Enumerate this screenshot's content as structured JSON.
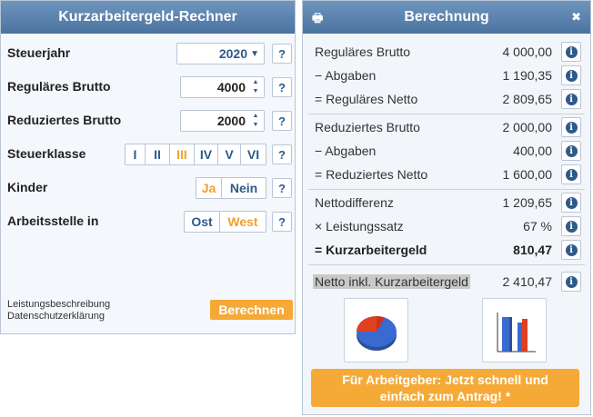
{
  "left": {
    "title": "Kurzarbeitergeld-Rechner",
    "help": "?",
    "steuerjahr": {
      "label": "Steuerjahr",
      "value": "2020"
    },
    "brutto": {
      "label": "Reguläres Brutto",
      "value": "4000"
    },
    "reduziert": {
      "label": "Reduziertes Brutto",
      "value": "2000"
    },
    "steuerklasse": {
      "label": "Steuerklasse",
      "options": [
        "I",
        "II",
        "III",
        "IV",
        "V",
        "VI"
      ],
      "selected": "III"
    },
    "kinder": {
      "label": "Kinder",
      "options": [
        "Ja",
        "Nein"
      ],
      "selected": "Ja"
    },
    "arbeitsstelle": {
      "label": "Arbeitsstelle in",
      "options": [
        "Ost",
        "West"
      ],
      "selected": "West"
    },
    "links": [
      "Leistungsbeschreibung",
      "Datenschutzerklärung"
    ],
    "calc_button": "Berechnen"
  },
  "right": {
    "title": "Berechnung",
    "info": "i",
    "rows": [
      {
        "label": "Reguläres Brutto",
        "value": "4 000,00"
      },
      {
        "label": "− Abgaben",
        "value": "1 190,35"
      },
      {
        "label": "= Reguläres Netto",
        "value": "2 809,65"
      },
      {
        "label": "Reduziertes Brutto",
        "value": "2 000,00"
      },
      {
        "label": "− Abgaben",
        "value": "400,00"
      },
      {
        "label": "= Reduziertes Netto",
        "value": "1 600,00"
      },
      {
        "label": "Nettodifferenz",
        "value": "1 209,65"
      },
      {
        "label": "× Leistungssatz",
        "value": "67 %"
      },
      {
        "label": "= Kurzarbeitergeld",
        "value": "810,47"
      },
      {
        "label": "Netto inkl. Kurzarbeitergeld",
        "value": "2 410,47"
      }
    ],
    "cta": "Für Arbeitgeber: Jetzt schnell und einfach zum Antrag! *"
  },
  "colors": {
    "accent": "#f5aa38",
    "header": "#4b73a0",
    "link": "#2e5a8a"
  }
}
